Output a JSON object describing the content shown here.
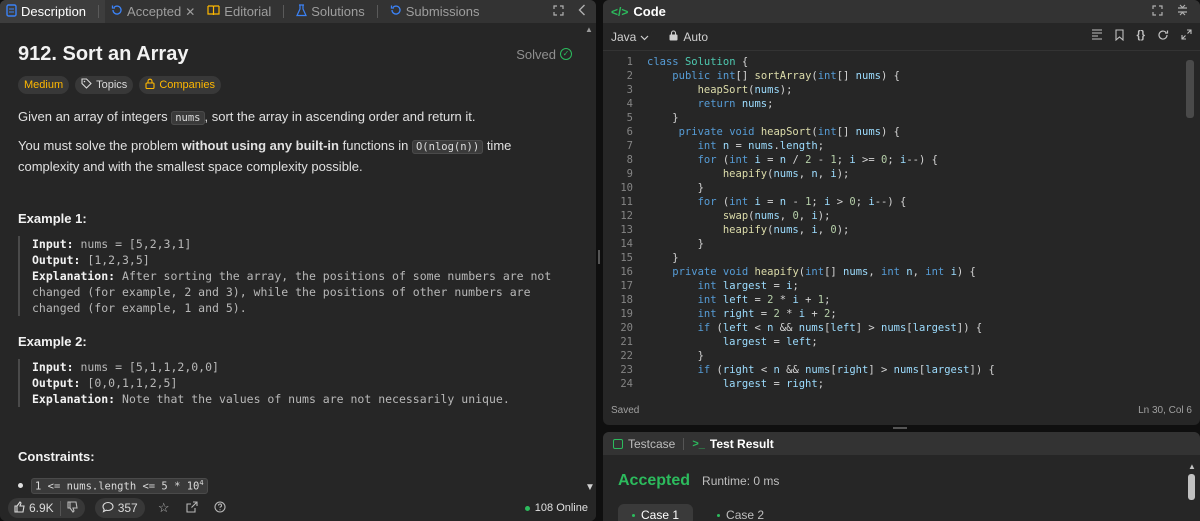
{
  "left_tabs": [
    {
      "label": "Description",
      "icon": "document-icon"
    },
    {
      "label": "Accepted",
      "icon": "history-icon"
    },
    {
      "label": "Editorial",
      "icon": "book-icon"
    },
    {
      "label": "Solutions",
      "icon": "flask-icon"
    },
    {
      "label": "Submissions",
      "icon": "history-icon"
    }
  ],
  "problem": {
    "title": "912. Sort an Array",
    "status": "Solved",
    "difficulty": "Medium",
    "topics_label": "Topics",
    "companies_label": "Companies",
    "intro_pre": "Given an array of integers ",
    "intro_code": "nums",
    "intro_post": ", sort the array in ascending order and return it.",
    "req_pre": "You must solve the problem ",
    "req_bold": "without using any built-in",
    "req_mid": " functions in ",
    "req_code": "O(nlog(n))",
    "req_post": " time complexity and with the smallest space complexity possible."
  },
  "examples": [
    {
      "title": "Example 1:",
      "input_label": "Input:",
      "input": " nums = [5,2,3,1]",
      "output_label": "Output:",
      "output": " [1,2,3,5]",
      "explanation_label": "Explanation:",
      "explanation": " After sorting the array, the positions of some numbers are not changed (for example, 2 and 3), while the positions of other numbers are changed (for example, 1 and 5)."
    },
    {
      "title": "Example 2:",
      "input_label": "Input:",
      "input": " nums = [5,1,1,2,0,0]",
      "output_label": "Output:",
      "output": " [0,0,1,1,2,5]",
      "explanation_label": "Explanation:",
      "explanation": " Note that the values of nums are not necessarily unique."
    }
  ],
  "constraints": {
    "title": "Constraints:",
    "first": "1 <= nums.length <= 5 * 10",
    "first_sup": "4"
  },
  "bottom_bar": {
    "likes": "6.9K",
    "comments": "357",
    "online": "108 Online"
  },
  "code_panel": {
    "title": "Code",
    "language": "Java",
    "mode": "Auto",
    "saved": "Saved",
    "cursor": "Ln 30, Col 6"
  },
  "code_lines": [
    "class Solution {",
    "    public int[] sortArray(int[] nums) {",
    "        heapSort(nums);",
    "        return nums;",
    "    }",
    "     private void heapSort(int[] nums) {",
    "        int n = nums.length;",
    "        for (int i = n / 2 - 1; i >= 0; i--) {",
    "            heapify(nums, n, i);",
    "        }",
    "        for (int i = n - 1; i > 0; i--) {",
    "            swap(nums, 0, i);",
    "            heapify(nums, i, 0);",
    "        }",
    "    }",
    "    private void heapify(int[] nums, int n, int i) {",
    "        int largest = i;",
    "        int left = 2 * i + 1;",
    "        int right = 2 * i + 2;",
    "        if (left < n && nums[left] > nums[largest]) {",
    "            largest = left;",
    "        }",
    "        if (right < n && nums[right] > nums[largest]) {",
    "            largest = right;"
  ],
  "test_panel": {
    "tab_testcase": "Testcase",
    "tab_result": "Test Result",
    "result": "Accepted",
    "runtime": "Runtime: 0 ms",
    "cases": [
      "Case 1",
      "Case 2"
    ]
  },
  "colors": {
    "accent_green": "#2cbb5d",
    "medium": "#ffb800",
    "blue": "#3b82f6"
  }
}
